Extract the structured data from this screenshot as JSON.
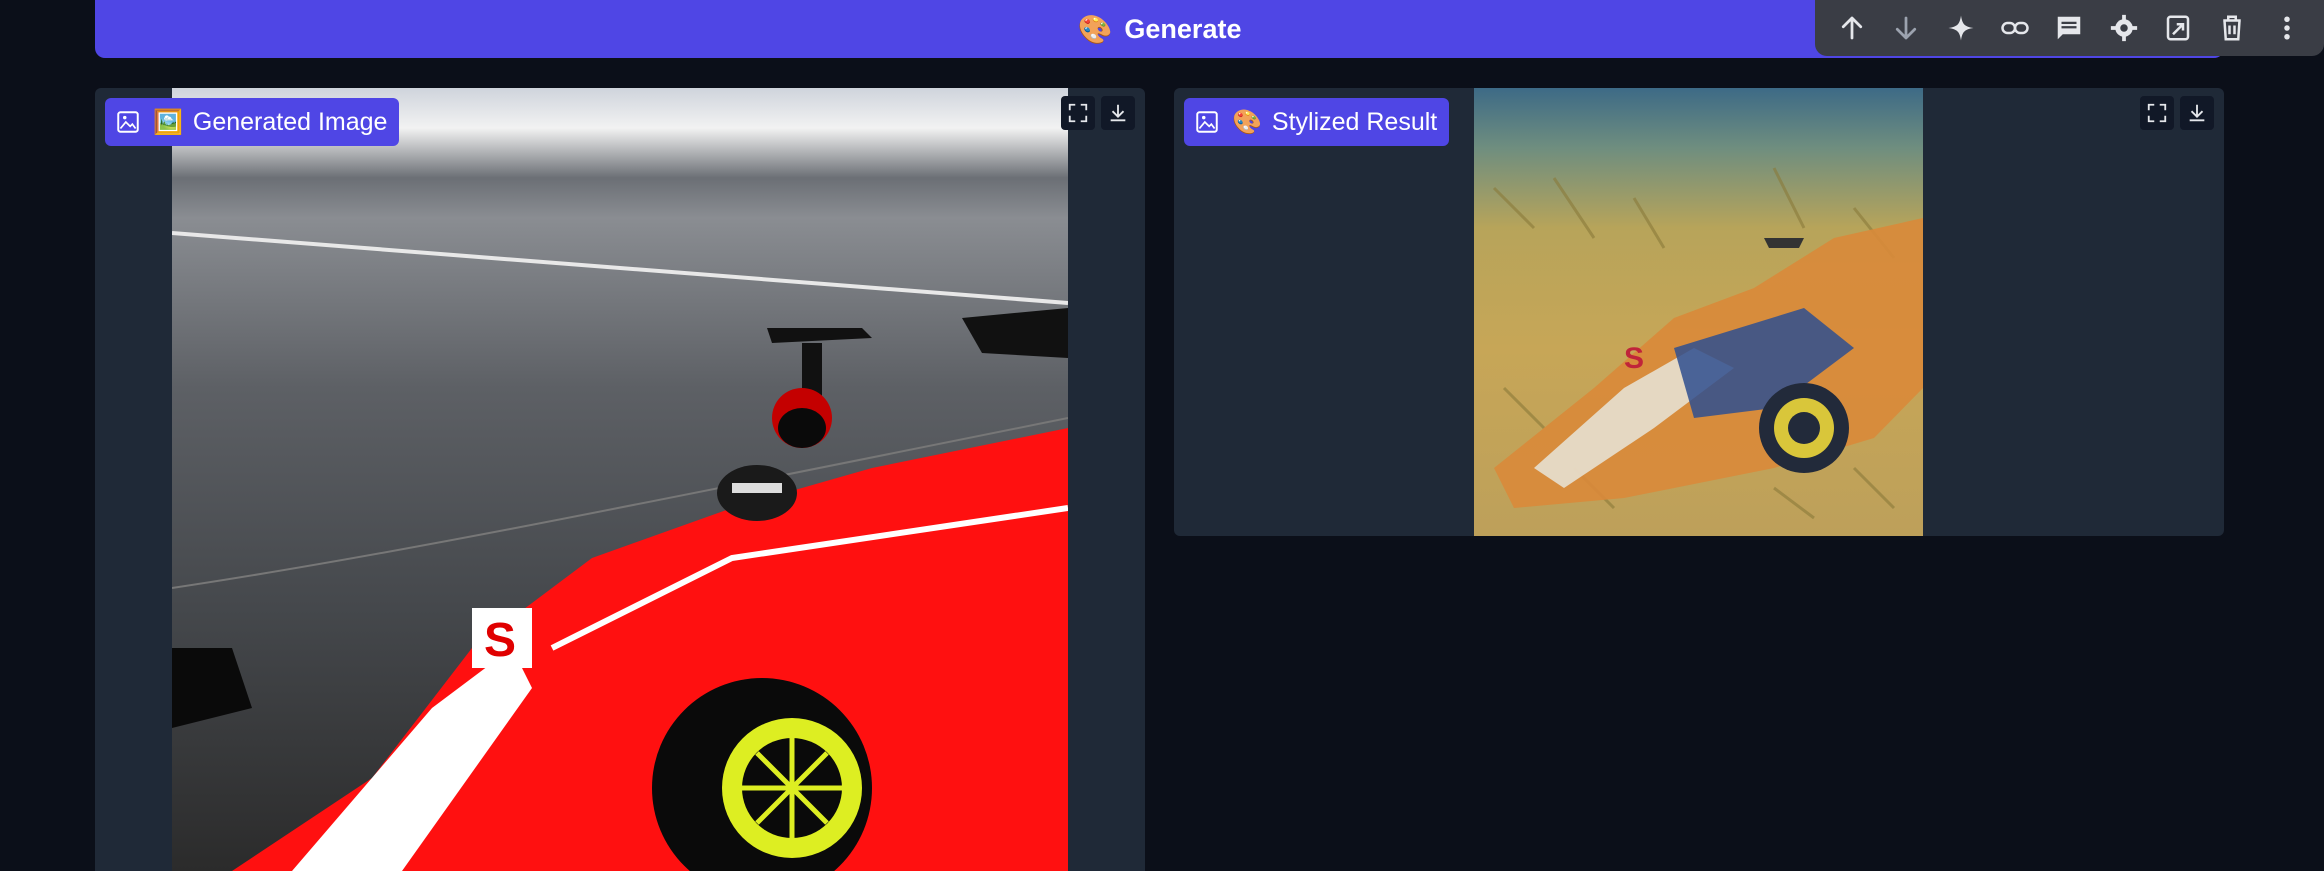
{
  "generate_button": {
    "emoji": "🎨",
    "label": "Generate"
  },
  "toolbar": {
    "items": [
      {
        "icon": "arrow-up-icon"
      },
      {
        "icon": "arrow-down-icon"
      },
      {
        "icon": "sparkle-icon"
      },
      {
        "icon": "link-icon"
      },
      {
        "icon": "comment-icon"
      },
      {
        "icon": "gear-icon"
      },
      {
        "icon": "swap-icon"
      },
      {
        "icon": "trash-icon"
      },
      {
        "icon": "more-vertical-icon"
      }
    ]
  },
  "panels": {
    "generated": {
      "emoji": "🖼️",
      "label": "Generated Image",
      "image_desc": "red race car on track"
    },
    "stylized": {
      "emoji": "🎨",
      "label": "Stylized Result",
      "image_desc": "painted stylized race car"
    }
  },
  "colors": {
    "accent": "#4f46e5",
    "background": "#0b0f19",
    "panel": "#1f2937",
    "toolbar": "#3a3d45"
  }
}
